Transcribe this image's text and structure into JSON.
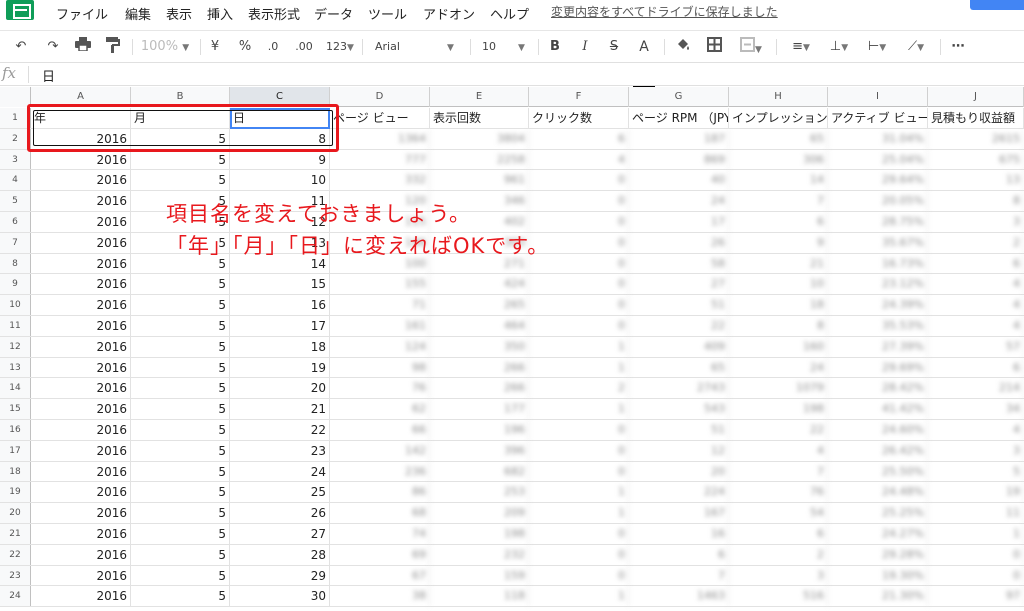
{
  "menu": {
    "items": [
      "ファイル",
      "編集",
      "表示",
      "挿入",
      "表示形式",
      "データ",
      "ツール",
      "アドオン",
      "ヘルプ"
    ],
    "save_status": "変更内容をすべてドライブに保存しました"
  },
  "toolbar": {
    "zoom": "100%",
    "currency": "¥",
    "percent": "%",
    "decimal_decrease": ".0",
    "decimal_increase": ".00",
    "number_format": "123",
    "font": "Arial",
    "font_size": "10",
    "bold": "B",
    "italic": "I",
    "strikethrough": "S",
    "text_color": "A",
    "more": "⋯"
  },
  "formula_bar": {
    "fx": "fx",
    "content": "日"
  },
  "grid": {
    "columns": [
      "A",
      "B",
      "C",
      "D",
      "E",
      "F",
      "G",
      "H",
      "I",
      "J"
    ],
    "selected_column": "C",
    "header_row": [
      "年",
      "月",
      "日",
      "ページ ビュー",
      "表示回数",
      "クリック数",
      "ページ RPM （JPY）",
      "インプレッション",
      "アクティブ ビュー",
      "見積もり収益額"
    ],
    "rows": [
      {
        "n": "2",
        "a": "2016",
        "b": "5",
        "c": "8",
        "blur": [
          "1364",
          "3804",
          "6",
          "187",
          "65",
          "31.04%",
          "2615"
        ]
      },
      {
        "n": "3",
        "a": "2016",
        "b": "5",
        "c": "9",
        "blur": [
          "777",
          "2258",
          "4",
          "869",
          "306",
          "25.04%",
          "675"
        ]
      },
      {
        "n": "4",
        "a": "2016",
        "b": "5",
        "c": "10",
        "blur": [
          "332",
          "961",
          "0",
          "40",
          "14",
          "29.64%",
          "13"
        ]
      },
      {
        "n": "5",
        "a": "2016",
        "b": "5",
        "c": "11",
        "blur": [
          "120",
          "346",
          "0",
          "24",
          "7",
          "20.05%",
          "8"
        ]
      },
      {
        "n": "6",
        "a": "2016",
        "b": "5",
        "c": "12",
        "blur": [
          "115",
          "402",
          "0",
          "17",
          "6",
          "28.75%",
          "3"
        ]
      },
      {
        "n": "7",
        "a": "2016",
        "b": "5",
        "c": "13",
        "blur": [
          "146",
          "303",
          "0",
          "26",
          "9",
          "35.67%",
          "2"
        ]
      },
      {
        "n": "8",
        "a": "2016",
        "b": "5",
        "c": "14",
        "blur": [
          "100",
          "271",
          "0",
          "58",
          "21",
          "16.73%",
          "6"
        ]
      },
      {
        "n": "9",
        "a": "2016",
        "b": "5",
        "c": "15",
        "blur": [
          "155",
          "424",
          "0",
          "27",
          "10",
          "23.12%",
          "4"
        ]
      },
      {
        "n": "10",
        "a": "2016",
        "b": "5",
        "c": "16",
        "blur": [
          "71",
          "265",
          "0",
          "51",
          "18",
          "24.39%",
          "4"
        ]
      },
      {
        "n": "11",
        "a": "2016",
        "b": "5",
        "c": "17",
        "blur": [
          "161",
          "464",
          "0",
          "22",
          "8",
          "35.53%",
          "4"
        ]
      },
      {
        "n": "12",
        "a": "2016",
        "b": "5",
        "c": "18",
        "blur": [
          "124",
          "350",
          "1",
          "409",
          "160",
          "27.39%",
          "57"
        ]
      },
      {
        "n": "13",
        "a": "2016",
        "b": "5",
        "c": "19",
        "blur": [
          "98",
          "266",
          "1",
          "65",
          "24",
          "29.69%",
          "6"
        ]
      },
      {
        "n": "14",
        "a": "2016",
        "b": "5",
        "c": "20",
        "blur": [
          "76",
          "266",
          "2",
          "2743",
          "1079",
          "28.42%",
          "214"
        ]
      },
      {
        "n": "15",
        "a": "2016",
        "b": "5",
        "c": "21",
        "blur": [
          "62",
          "177",
          "1",
          "543",
          "198",
          "41.42%",
          "34"
        ]
      },
      {
        "n": "16",
        "a": "2016",
        "b": "5",
        "c": "22",
        "blur": [
          "66",
          "196",
          "0",
          "51",
          "22",
          "24.60%",
          "4"
        ]
      },
      {
        "n": "17",
        "a": "2016",
        "b": "5",
        "c": "23",
        "blur": [
          "142",
          "396",
          "0",
          "12",
          "4",
          "26.42%",
          "3"
        ]
      },
      {
        "n": "18",
        "a": "2016",
        "b": "5",
        "c": "24",
        "blur": [
          "236",
          "682",
          "0",
          "20",
          "7",
          "25.50%",
          "5"
        ]
      },
      {
        "n": "19",
        "a": "2016",
        "b": "5",
        "c": "25",
        "blur": [
          "86",
          "253",
          "1",
          "224",
          "76",
          "24.48%",
          "19"
        ]
      },
      {
        "n": "20",
        "a": "2016",
        "b": "5",
        "c": "26",
        "blur": [
          "68",
          "209",
          "1",
          "167",
          "54",
          "25.25%",
          "11"
        ]
      },
      {
        "n": "21",
        "a": "2016",
        "b": "5",
        "c": "27",
        "blur": [
          "74",
          "198",
          "0",
          "16",
          "6",
          "24.27%",
          "1"
        ]
      },
      {
        "n": "22",
        "a": "2016",
        "b": "5",
        "c": "28",
        "blur": [
          "69",
          "232",
          "0",
          "6",
          "2",
          "29.28%",
          "0"
        ]
      },
      {
        "n": "23",
        "a": "2016",
        "b": "5",
        "c": "29",
        "blur": [
          "67",
          "159",
          "0",
          "7",
          "3",
          "19.30%",
          "0"
        ]
      },
      {
        "n": "24",
        "a": "2016",
        "b": "5",
        "c": "30",
        "blur": [
          "38",
          "118",
          "1",
          "1463",
          "516",
          "21.30%",
          "97"
        ]
      }
    ]
  },
  "annotation": {
    "line1": "項目名を変えておきましょう。",
    "line2": "「年」「月」「日」に変えればOKです。",
    "color": "#e8181d"
  }
}
